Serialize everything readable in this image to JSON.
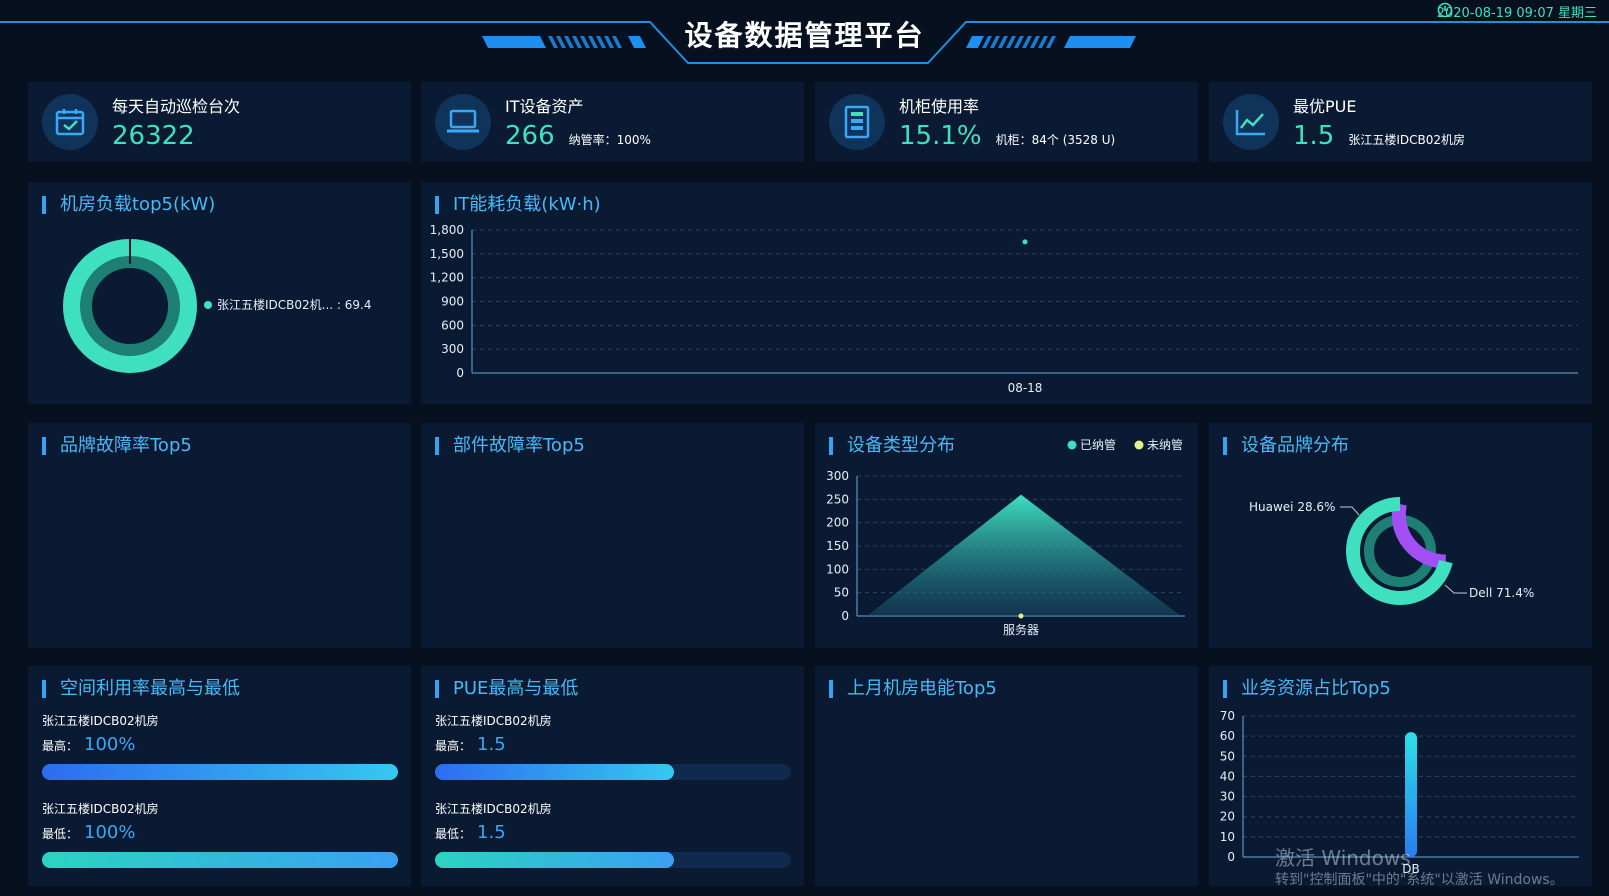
{
  "header": {
    "title": "设备数据管理平台",
    "datetime": "2020-08-19 09:07 星期三"
  },
  "stats": [
    {
      "label": "每天自动巡检台次",
      "value": "26322",
      "sub": "",
      "icon": "calendar-check-icon"
    },
    {
      "label": "IT设备资产",
      "value": "266",
      "sub": "纳管率：100%",
      "icon": "laptop-icon"
    },
    {
      "label": "机柜使用率",
      "value": "15.1%",
      "sub": "机柜：84个 (3528 U)",
      "icon": "cabinet-icon"
    },
    {
      "label": "最优PUE",
      "value": "1.5",
      "sub": "张江五楼IDCB02机房",
      "icon": "line-chart-icon"
    }
  ],
  "panels": {
    "room_load": "机房负载top5(kW)",
    "it_energy": "IT能耗负载(kW·h)",
    "brand_fault": "品牌故障率Top5",
    "part_fault": "部件故障率Top5",
    "device_type": "设备类型分布",
    "device_brand": "设备品牌分布",
    "space_util": "空间利用率最高与最低",
    "pue_range": "PUE最高与最低",
    "last_month_power": "上月机房电能Top5",
    "biz_resource": "业务资源占比Top5"
  },
  "room_load_legend": "张江五楼IDCB02机... : 69.4",
  "device_type_legend": {
    "managed": "已纳管",
    "unmanaged": "未纳管"
  },
  "brand_labels": {
    "huawei": "Huawei 28.6%",
    "dell": "Dell 71.4%"
  },
  "space": {
    "high": {
      "location": "张江五楼IDCB02机房",
      "label": "最高：",
      "value": "100%",
      "fraction": 1.0
    },
    "low": {
      "location": "张江五楼IDCB02机房",
      "label": "最低：",
      "value": "100%",
      "fraction": 1.0
    }
  },
  "pue": {
    "high": {
      "location": "张江五楼IDCB02机房",
      "label": "最高：",
      "value": "1.5",
      "fraction": 0.67
    },
    "low": {
      "location": "张江五楼IDCB02机房",
      "label": "最低：",
      "value": "1.5",
      "fraction": 0.67
    }
  },
  "watermark": {
    "line1": "激活 Windows",
    "line2": "转到\"控制面板\"中的\"系统\"以激活 Windows。"
  },
  "colors": {
    "accent": "#3fe0c0",
    "blue": "#36a2f0",
    "purple": "#a24ff5",
    "panel": "#0a1a33"
  },
  "chart_data": [
    {
      "type": "pie",
      "title": "机房负载top5(kW)",
      "labels": [
        "张江五楼IDCB02机房"
      ],
      "values": [
        69.4
      ]
    },
    {
      "type": "line",
      "title": "IT能耗负载(kW·h)",
      "x": [
        "08-18"
      ],
      "y": [
        1650
      ],
      "ylim": [
        0,
        1800
      ],
      "yticks": [
        0,
        300,
        600,
        900,
        1200,
        1500,
        1800
      ],
      "grid": true
    },
    {
      "type": "area",
      "title": "设备类型分布",
      "categories": [
        "服务器"
      ],
      "series": [
        {
          "name": "已纳管",
          "values": [
            260
          ]
        },
        {
          "name": "未纳管",
          "values": [
            0
          ]
        }
      ],
      "ylim": [
        0,
        300
      ],
      "yticks": [
        0,
        50,
        100,
        150,
        200,
        250,
        300
      ]
    },
    {
      "type": "pie",
      "title": "设备品牌分布",
      "labels": [
        "Huawei",
        "Dell"
      ],
      "values": [
        28.6,
        71.4
      ]
    },
    {
      "type": "bar",
      "title": "业务资源占比Top5",
      "categories": [
        "DB"
      ],
      "values": [
        62
      ],
      "ylim": [
        0,
        70
      ],
      "yticks": [
        0,
        10,
        20,
        30,
        40,
        50,
        60,
        70
      ]
    }
  ]
}
